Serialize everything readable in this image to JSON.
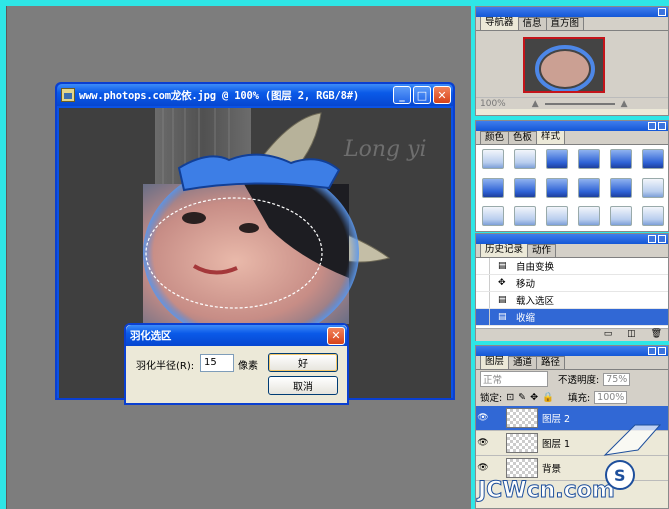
{
  "document_window": {
    "title": "www.photops.com龙依.jpg @ 100% (图层 2, RGB/8#)",
    "canvas_text": "Long yi"
  },
  "dialog": {
    "title": "羽化选区",
    "radius_label": "羽化半径(R):",
    "radius_value": "15",
    "unit": "像素",
    "ok_label": "好",
    "cancel_label": "取消"
  },
  "navigator_panel": {
    "tabs": [
      "导航器",
      "信息",
      "直方图"
    ],
    "zoom": "100%"
  },
  "styles_panel": {
    "tabs": [
      "颜色",
      "色板",
      "样式"
    ],
    "swatch_count": 18
  },
  "history_panel": {
    "tabs": [
      "历史记录",
      "动作"
    ],
    "items": [
      "自由变换",
      "移动",
      "载入选区",
      "收缩"
    ],
    "selected_index": 3
  },
  "layers_panel": {
    "tabs": [
      "图层",
      "通道",
      "路径"
    ],
    "blend_mode": "正常",
    "opacity_label": "不透明度:",
    "opacity_value": "75%",
    "lock_label": "锁定:",
    "fill_label": "填充:",
    "fill_value": "100%",
    "layers": [
      "图层 2",
      "图层 1",
      "背景"
    ],
    "selected_index": 0
  },
  "watermark": {
    "text": "JCWcn.com"
  }
}
